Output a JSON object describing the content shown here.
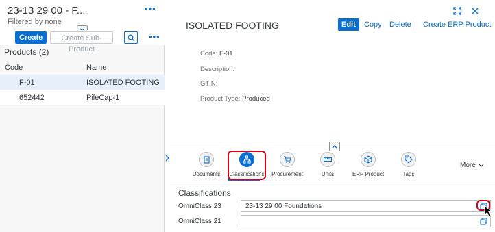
{
  "left_pane": {
    "title": "23-13 29 00 - F...",
    "subtitle": "Filtered by none",
    "more_label": "•••",
    "toolbar": {
      "create_label": "Create",
      "create_subproduct_label": "Create Sub-Product",
      "more_label": "•••"
    },
    "list_heading": "Products (2)",
    "table": {
      "columns": [
        "Code",
        "Name"
      ],
      "rows": [
        {
          "code": "F-01",
          "name": "ISOLATED FOOTING",
          "selected": true
        },
        {
          "code": "652442",
          "name": "PileCap-1",
          "selected": false
        }
      ]
    }
  },
  "right_pane": {
    "title": "ISOLATED FOOTING",
    "actions": {
      "edit": "Edit",
      "copy": "Copy",
      "delete": "Delete",
      "create_erp": "Create ERP Product"
    },
    "attributes": {
      "code_label": "Code:",
      "code_value": "F-01",
      "description_label": "Description:",
      "gtin_label": "GTIN:",
      "product_type_label": "Product Type:",
      "product_type_value": "Produced"
    },
    "tabs": [
      {
        "label": "Documents",
        "icon": "documents-icon"
      },
      {
        "label": "Classifications",
        "icon": "classifications-icon",
        "active": true
      },
      {
        "label": "Procurement",
        "icon": "cart-icon"
      },
      {
        "label": "Units",
        "icon": "units-icon"
      },
      {
        "label": "ERP Product",
        "icon": "erp-product-icon"
      },
      {
        "label": "Tags",
        "icon": "tags-icon"
      }
    ],
    "more_label": "More",
    "section": {
      "title": "Classifications",
      "fields": [
        {
          "label": "OmniClass 23",
          "value": "23-13 29 00 Foundations"
        },
        {
          "label": "OmniClass 21",
          "value": ""
        }
      ]
    }
  },
  "colors": {
    "accent": "#0a6ed1",
    "highlight": "#d0021b",
    "selected_row": "#e5f0fa"
  }
}
